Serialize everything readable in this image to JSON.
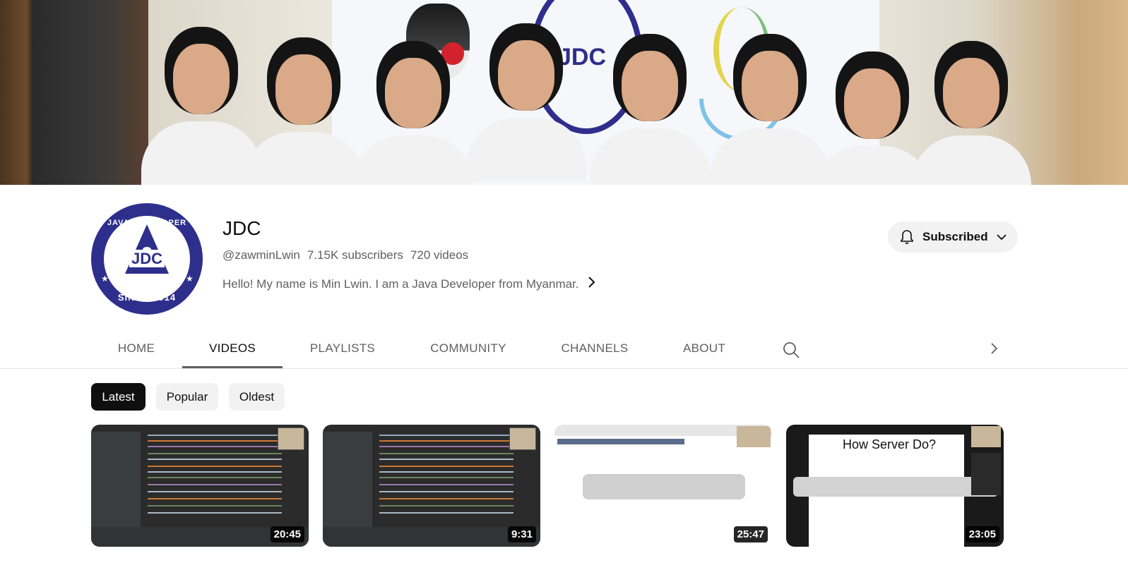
{
  "channel": {
    "name": "JDC",
    "handle": "@zawminLwin",
    "subscribers": "7.15K subscribers",
    "videos": "720 videos",
    "description": "Hello! My name is Min Lwin. I am a Java Developer from Myanmar.",
    "avatar": {
      "top_text": "JAVA DEVELOPER CLASS",
      "center_text": "JDC",
      "bottom_text": "SINCE 2014"
    },
    "banner": {
      "crest_text": "JDC"
    }
  },
  "subscribe_button": {
    "label": "Subscribed"
  },
  "tabs": [
    {
      "label": "HOME"
    },
    {
      "label": "VIDEOS"
    },
    {
      "label": "PLAYLISTS"
    },
    {
      "label": "COMMUNITY"
    },
    {
      "label": "CHANNELS"
    },
    {
      "label": "ABOUT"
    }
  ],
  "active_tab": "VIDEOS",
  "chips": [
    {
      "label": "Latest"
    },
    {
      "label": "Popular"
    },
    {
      "label": "Oldest"
    }
  ],
  "active_chip": "Latest",
  "videos": [
    {
      "duration": "20:45"
    },
    {
      "duration": "9:31"
    },
    {
      "duration": "25:47"
    },
    {
      "duration": "23:05",
      "slide_title": "How Server Do?"
    }
  ],
  "icons": {
    "bell": "bell-icon",
    "dropdown": "chevron-down-icon",
    "description_more": "chevron-right-icon",
    "search": "search-icon",
    "tabs_next": "chevron-right-icon"
  },
  "colors": {
    "brand_navy": "#2e2f8c",
    "chip_active_bg": "#0f0f0f",
    "chip_bg": "#f2f2f2",
    "secondary_text": "#606060"
  }
}
